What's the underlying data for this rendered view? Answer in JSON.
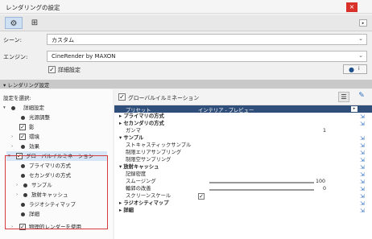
{
  "window": {
    "title": "レンダリングの設定",
    "close_glyph": "×"
  },
  "toolbar": {
    "scroll_glyph": "▸"
  },
  "form": {
    "scene_label": "シーン:",
    "scene_value": "カスタム",
    "engine_label": "エンジン:",
    "engine_value": "CineRender by MAXON",
    "detail_label": "詳細設定"
  },
  "section": {
    "title": "レンダリング設定"
  },
  "left": {
    "heading": "設定を選択:",
    "items": [
      "詳細設定",
      "光源調整",
      "影",
      "環境",
      "効果",
      "グローバルイルミネーション",
      "プライマリの方式",
      "セカンダリの方式",
      "サンプル",
      "放射キャッシュ",
      "ラジオシティマップ",
      "詳細",
      "物理的レンダーを使用"
    ]
  },
  "right": {
    "heading": "グローバルイルミネーション",
    "preset_label": "プリセット",
    "preset_value": "インテリア - プレビュー",
    "rows": [
      "プライマリの方式",
      "セカンダリの方式",
      "ガンマ",
      "サンプル",
      "ストキャスティックサンプル",
      "制限エリアサンプリング",
      "制限空サンプリング",
      "放射キャッシュ",
      "記録密度",
      "スムージング",
      "輪郭の改善",
      "スクリーンスケール",
      "ラジオシティマップ",
      "詳細"
    ],
    "gamma_value": "1",
    "smoothing_value": "100",
    "contour_value": "0"
  }
}
